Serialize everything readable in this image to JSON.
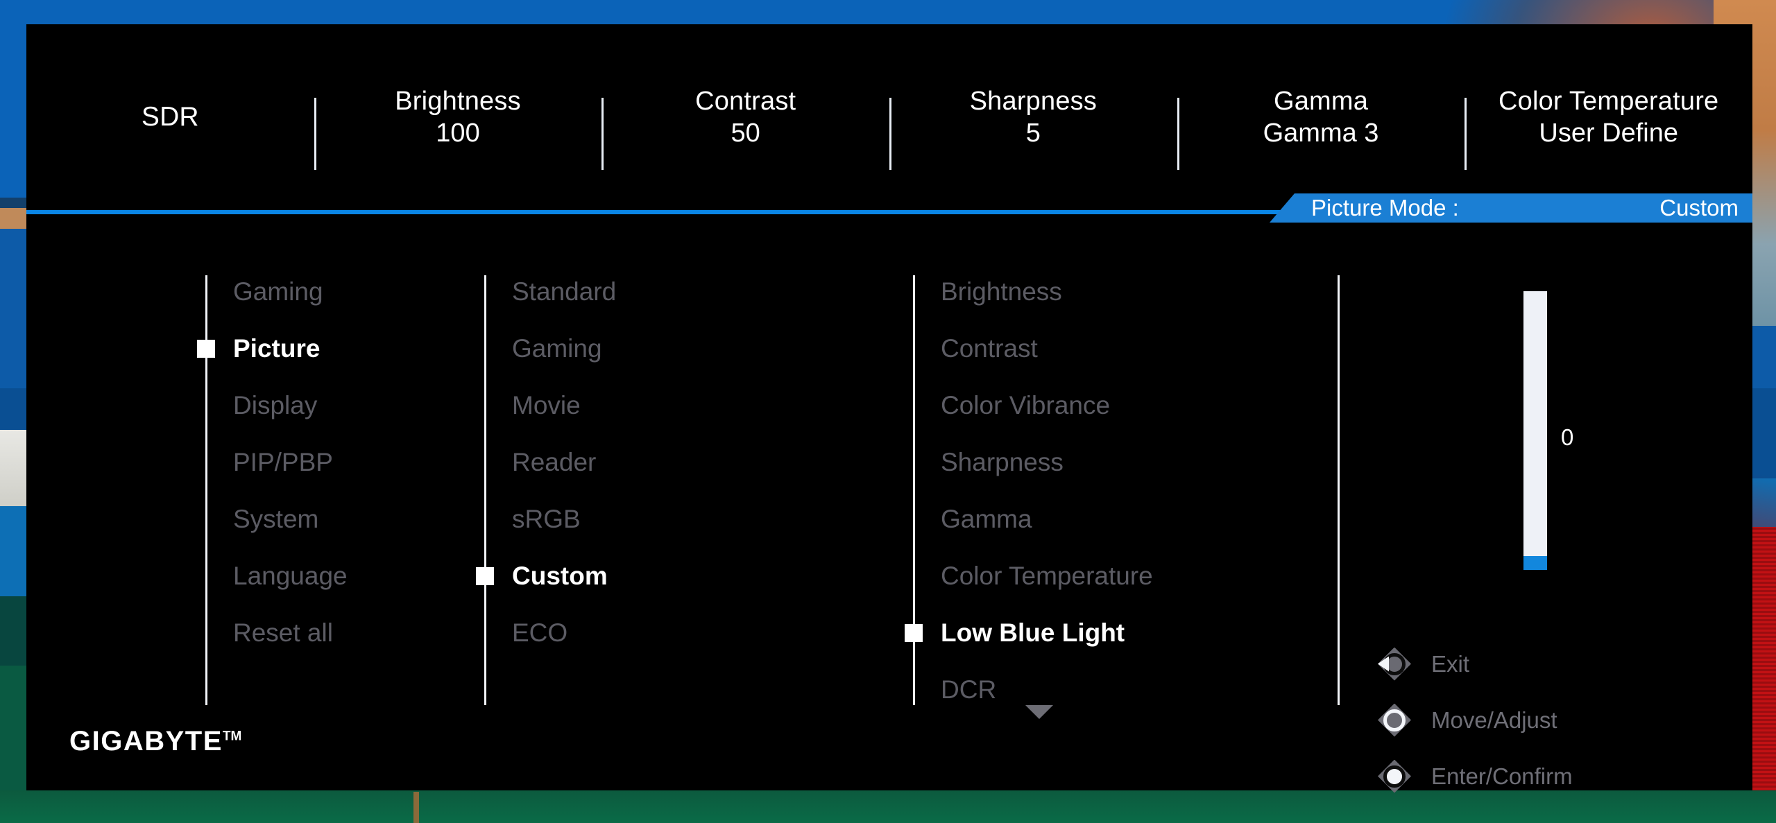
{
  "top_bar": {
    "items": [
      {
        "label": "SDR",
        "value": ""
      },
      {
        "label": "Brightness",
        "value": "100"
      },
      {
        "label": "Contrast",
        "value": "50"
      },
      {
        "label": "Sharpness",
        "value": "5"
      },
      {
        "label": "Gamma",
        "value": "Gamma 3"
      },
      {
        "label": "Color Temperature",
        "value": "User Define"
      }
    ]
  },
  "mode_banner": {
    "label": "Picture Mode  :",
    "value": "Custom"
  },
  "columns": {
    "level1": [
      {
        "label": "Gaming",
        "selected": false
      },
      {
        "label": "Picture",
        "selected": true
      },
      {
        "label": "Display",
        "selected": false
      },
      {
        "label": "PIP/PBP",
        "selected": false
      },
      {
        "label": "System",
        "selected": false
      },
      {
        "label": "Language",
        "selected": false
      },
      {
        "label": "Reset all",
        "selected": false
      }
    ],
    "level2": [
      {
        "label": "Standard",
        "selected": false
      },
      {
        "label": "Gaming",
        "selected": false
      },
      {
        "label": "Movie",
        "selected": false
      },
      {
        "label": "Reader",
        "selected": false
      },
      {
        "label": "sRGB",
        "selected": false
      },
      {
        "label": "Custom",
        "selected": true
      },
      {
        "label": "ECO",
        "selected": false
      }
    ],
    "level3": [
      {
        "label": "Brightness",
        "selected": false
      },
      {
        "label": "Contrast",
        "selected": false
      },
      {
        "label": "Color Vibrance",
        "selected": false
      },
      {
        "label": "Sharpness",
        "selected": false
      },
      {
        "label": "Gamma",
        "selected": false
      },
      {
        "label": "Color Temperature",
        "selected": false
      },
      {
        "label": "Low Blue Light",
        "selected": true
      },
      {
        "label": "DCR",
        "selected": false
      }
    ],
    "more_indicator": "chevron-down"
  },
  "slider": {
    "value": "0",
    "min": 0,
    "max": 100,
    "fill_percent": 5,
    "orientation": "vertical"
  },
  "legend": [
    {
      "icon": "joystick-left-icon",
      "label": "Exit"
    },
    {
      "icon": "joystick-ring-icon",
      "label": "Move/Adjust"
    },
    {
      "icon": "joystick-center-icon",
      "label": "Enter/Confirm"
    }
  ],
  "brand": {
    "name": "GIGABYTE",
    "trademark": "TM"
  },
  "colors": {
    "accent_blue": "#0a86e6",
    "banner_blue": "#1b7fd4",
    "slider_fill": "#1287dd",
    "panel_bg": "#000000",
    "text_active": "#ffffff",
    "text_inactive": "#5c5c64"
  }
}
